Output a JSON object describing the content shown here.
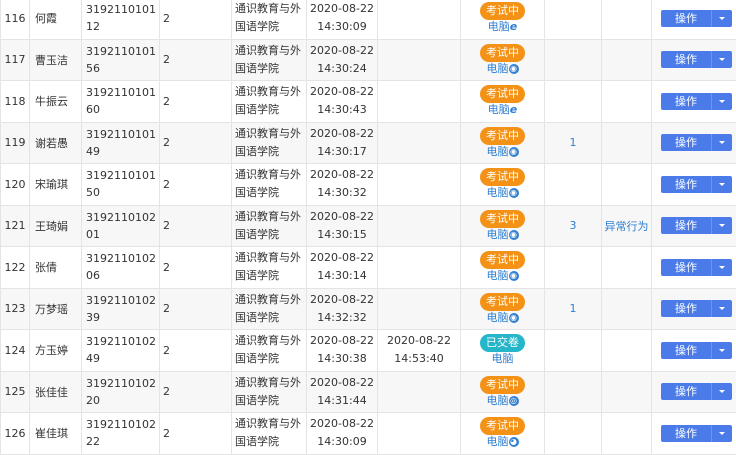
{
  "college": [
    "通识教育与外",
    "国语学院"
  ],
  "device_label": "电脑",
  "action_label": "操作",
  "rows": [
    {
      "idx": "116",
      "name": "何霞",
      "sid": "319211010112",
      "n": "2",
      "date": "2020-08-22",
      "time": "14:30:09",
      "end_date": "",
      "end_time": "",
      "status": "考试中",
      "status_color": "orange",
      "icon": "e",
      "count": "",
      "flag": ""
    },
    {
      "idx": "117",
      "name": "曹玉洁",
      "sid": "319211010156",
      "n": "2",
      "date": "2020-08-22",
      "time": "14:30:24",
      "end_date": "",
      "end_time": "",
      "status": "考试中",
      "status_color": "orange",
      "icon": "chrome",
      "count": "",
      "flag": ""
    },
    {
      "idx": "118",
      "name": "牛振云",
      "sid": "319211010160",
      "n": "2",
      "date": "2020-08-22",
      "time": "14:30:43",
      "end_date": "",
      "end_time": "",
      "status": "考试中",
      "status_color": "orange",
      "icon": "e",
      "count": "",
      "flag": ""
    },
    {
      "idx": "119",
      "name": "谢若愚",
      "sid": "319211010149",
      "n": "2",
      "date": "2020-08-22",
      "time": "14:30:17",
      "end_date": "",
      "end_time": "",
      "status": "考试中",
      "status_color": "orange",
      "icon": "chrome",
      "count": "1",
      "flag": ""
    },
    {
      "idx": "120",
      "name": "宋瑜琪",
      "sid": "319211010150",
      "n": "2",
      "date": "2020-08-22",
      "time": "14:30:32",
      "end_date": "",
      "end_time": "",
      "status": "考试中",
      "status_color": "orange",
      "icon": "chrome",
      "count": "",
      "flag": ""
    },
    {
      "idx": "121",
      "name": "王琦娟",
      "sid": "319211010201",
      "n": "2",
      "date": "2020-08-22",
      "time": "14:30:15",
      "end_date": "",
      "end_time": "",
      "status": "考试中",
      "status_color": "orange",
      "icon": "chrome",
      "count": "3",
      "flag": "异常行为"
    },
    {
      "idx": "122",
      "name": "张倩",
      "sid": "319211010206",
      "n": "2",
      "date": "2020-08-22",
      "time": "14:30:14",
      "end_date": "",
      "end_time": "",
      "status": "考试中",
      "status_color": "orange",
      "icon": "chrome",
      "count": "",
      "flag": ""
    },
    {
      "idx": "123",
      "name": "万梦瑶",
      "sid": "319211010239",
      "n": "2",
      "date": "2020-08-22",
      "time": "14:32:32",
      "end_date": "",
      "end_time": "",
      "status": "考试中",
      "status_color": "orange",
      "icon": "chrome",
      "count": "1",
      "flag": ""
    },
    {
      "idx": "124",
      "name": "方玉婷",
      "sid": "319211010249",
      "n": "2",
      "date": "2020-08-22",
      "time": "14:30:38",
      "end_date": "2020-08-22",
      "end_time": "14:53:40",
      "status": "已交卷",
      "status_color": "teal",
      "icon": "",
      "count": "",
      "flag": ""
    },
    {
      "idx": "125",
      "name": "张佳佳",
      "sid": "319211010220",
      "n": "2",
      "date": "2020-08-22",
      "time": "14:31:44",
      "end_date": "",
      "end_time": "",
      "status": "考试中",
      "status_color": "orange",
      "icon": "safari",
      "count": "",
      "flag": ""
    },
    {
      "idx": "126",
      "name": "崔佳琪",
      "sid": "319211010222",
      "n": "2",
      "date": "2020-08-22",
      "time": "14:30:09",
      "end_date": "",
      "end_time": "",
      "status": "考试中",
      "status_color": "orange",
      "icon": "edge",
      "count": "",
      "flag": ""
    }
  ]
}
